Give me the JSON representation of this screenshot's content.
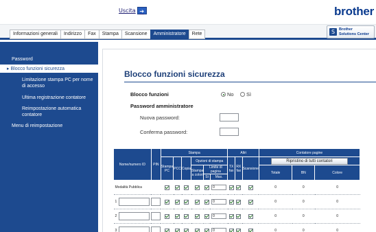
{
  "header": {
    "logout_label": "Uscita",
    "logout_icon": "arrow-right-icon",
    "brand": "brother",
    "solutions_center": [
      "Brother",
      "Solutions Center"
    ]
  },
  "tabs": [
    {
      "label": "Informazioni generali",
      "active": false
    },
    {
      "label": "Indirizzo",
      "active": false
    },
    {
      "label": "Fax",
      "active": false
    },
    {
      "label": "Stampa",
      "active": false
    },
    {
      "label": "Scansione",
      "active": false
    },
    {
      "label": "Amministratore",
      "active": true
    },
    {
      "label": "Rete",
      "active": false
    }
  ],
  "sidebar": {
    "items": [
      {
        "label": "Password"
      },
      {
        "label": "Blocco funzioni sicurezza",
        "active": true
      },
      {
        "label": "Limitazione stampa PC per nome di accesso"
      },
      {
        "label": "Ultima registrazione contatore"
      },
      {
        "label": "Reimpostazione automatica contatore"
      },
      {
        "label": "Menu di reimpostazione"
      }
    ]
  },
  "main": {
    "title": "Blocco funzioni sicurezza",
    "lock_label": "Blocco funzioni",
    "radio_no": "No",
    "radio_yes": "Sì",
    "admin_pw_label": "Password amministratore",
    "new_pw_label": "Nuova password:",
    "confirm_pw_label": "Conferma password:"
  },
  "table": {
    "headers": {
      "name_id": "Nome/numero ID",
      "pin": "PIN",
      "print": "Stampa",
      "others": "Altri",
      "page_counter": "Contatore pagine",
      "pc_print": "Stampa PC",
      "pcc": "PCC",
      "copy": "Copia",
      "print_options": "Opzioni di stampa",
      "color_print": "Stampa a colori",
      "page_limit": "Limite di pagina",
      "yes": "Sì",
      "max": "Max.",
      "tx_fax": "TX fax",
      "rx_fax": "RX fax",
      "scan": "Scansione",
      "reset_all": "Ripristino di tutti contatori",
      "total": "Totale",
      "bw": "BN",
      "color": "Colore"
    },
    "rows": [
      {
        "label": "Modalità Pubblica",
        "num": "",
        "max": "0",
        "total": "0",
        "bw": "0",
        "color": "0"
      },
      {
        "label": "",
        "num": "1",
        "max": "0",
        "total": "0",
        "bw": "0",
        "color": "0"
      },
      {
        "label": "",
        "num": "2",
        "max": "0",
        "total": "0",
        "bw": "0",
        "color": "0"
      },
      {
        "label": "",
        "num": "3",
        "max": "0",
        "total": "0",
        "bw": "0",
        "color": "0"
      }
    ]
  }
}
